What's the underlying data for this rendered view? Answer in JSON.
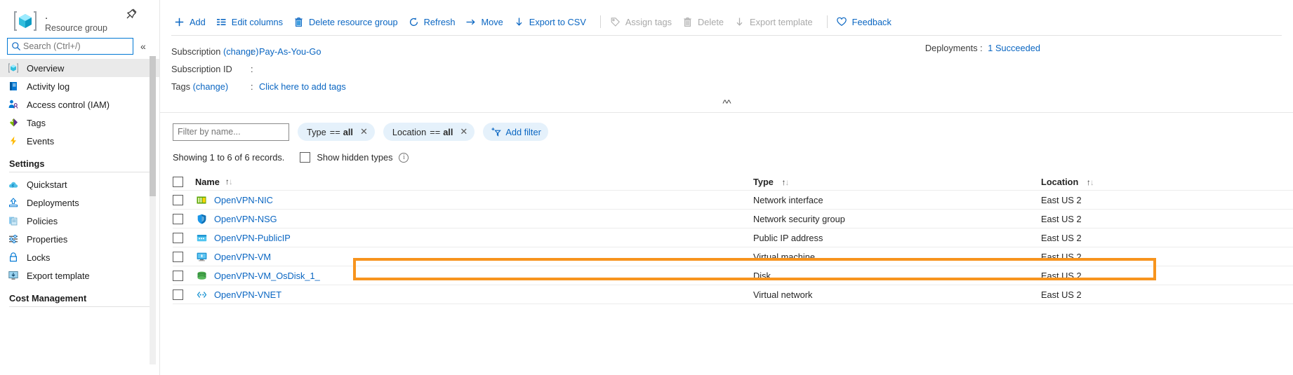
{
  "header": {
    "title": ".",
    "subtitle": "Resource group",
    "pin_icon": "pin-icon",
    "resource_group_icon": "resource-group-icon"
  },
  "search": {
    "placeholder": "Search (Ctrl+/)",
    "icon": "search-icon",
    "collapse_icon": "double-chevron-left-icon"
  },
  "sidebar": {
    "items": [
      {
        "label": "Overview",
        "icon": "resource-group-icon",
        "selected": true
      },
      {
        "label": "Activity log",
        "icon": "activity-log-icon",
        "selected": false
      },
      {
        "label": "Access control (IAM)",
        "icon": "access-control-icon",
        "selected": false
      },
      {
        "label": "Tags",
        "icon": "tags-icon",
        "selected": false
      },
      {
        "label": "Events",
        "icon": "events-icon",
        "selected": false
      }
    ],
    "groups": [
      {
        "title": "Settings",
        "items": [
          {
            "label": "Quickstart",
            "icon": "quickstart-icon"
          },
          {
            "label": "Deployments",
            "icon": "deployments-icon"
          },
          {
            "label": "Policies",
            "icon": "policies-icon"
          },
          {
            "label": "Properties",
            "icon": "properties-icon"
          },
          {
            "label": "Locks",
            "icon": "lock-icon"
          },
          {
            "label": "Export template",
            "icon": "export-template-icon"
          }
        ]
      },
      {
        "title": "Cost Management",
        "items": []
      }
    ]
  },
  "toolbar": {
    "buttons": [
      {
        "label": "Add",
        "icon": "plus-icon",
        "disabled": false
      },
      {
        "label": "Edit columns",
        "icon": "edit-columns-icon",
        "disabled": false
      },
      {
        "label": "Delete resource group",
        "icon": "trash-icon",
        "disabled": false
      },
      {
        "label": "Refresh",
        "icon": "refresh-icon",
        "disabled": false
      },
      {
        "label": "Move",
        "icon": "arrow-right-icon",
        "disabled": false
      },
      {
        "label": "Export to CSV",
        "icon": "download-icon",
        "disabled": false
      },
      {
        "label": "Assign tags",
        "icon": "tag-icon",
        "disabled": true
      },
      {
        "label": "Delete",
        "icon": "trash-icon",
        "disabled": true
      },
      {
        "label": "Export template",
        "icon": "download-icon",
        "disabled": true
      },
      {
        "label": "Feedback",
        "icon": "heart-icon",
        "disabled": false
      }
    ]
  },
  "properties": {
    "subscription_label": "Subscription",
    "subscription_change": "(change)",
    "subscription_value": "Pay-As-You-Go",
    "subscription_id_label": "Subscription ID",
    "subscription_id_value": "",
    "tags_label": "Tags",
    "tags_change": "(change)",
    "tags_value": "Click here to add tags",
    "colon": ":",
    "deployments_label": "Deployments",
    "deployments_value": "1 Succeeded",
    "collapse_icon": "double-chevron-up-icon"
  },
  "filters": {
    "name_placeholder": "Filter by name...",
    "name_value": "",
    "pills": [
      {
        "field": "Type",
        "op": "==",
        "value": "all",
        "close_icon": "close-icon"
      },
      {
        "field": "Location",
        "op": "==",
        "value": "all",
        "close_icon": "close-icon"
      }
    ],
    "add_filter_label": "Add filter",
    "add_filter_icon": "add-filter-icon"
  },
  "list_status": {
    "showing_text": "Showing 1 to 6 of 6 records.",
    "show_hidden_label": "Show hidden types",
    "show_hidden_checked": false,
    "info_icon": "info-icon"
  },
  "table": {
    "columns": [
      {
        "label": "Name",
        "sort_icon": "sort-updown-icon"
      },
      {
        "label": "Type",
        "sort_icon": "sort-updown-icon"
      },
      {
        "label": "Location",
        "sort_icon": "sort-updown-icon"
      }
    ],
    "rows": [
      {
        "name": "OpenVPN-NIC",
        "type": "Network interface",
        "location": "East US 2",
        "icon": "network-interface-icon",
        "highlighted": false
      },
      {
        "name": "OpenVPN-NSG",
        "type": "Network security group",
        "location": "East US 2",
        "icon": "network-security-group-icon",
        "highlighted": true
      },
      {
        "name": "OpenVPN-PublicIP",
        "type": "Public IP address",
        "location": "East US 2",
        "icon": "public-ip-icon",
        "highlighted": false
      },
      {
        "name": "OpenVPN-VM",
        "type": "Virtual machine",
        "location": "East US 2",
        "icon": "virtual-machine-icon",
        "highlighted": false
      },
      {
        "name": "OpenVPN-VM_OsDisk_1_",
        "type": "Disk",
        "location": "East US 2",
        "icon": "disk-icon",
        "highlighted": false
      },
      {
        "name": "OpenVPN-VNET",
        "type": "Virtual network",
        "location": "East US 2",
        "icon": "virtual-network-icon",
        "highlighted": false
      }
    ]
  },
  "colors": {
    "accent_link": "#0a66c2",
    "highlight_orange": "#f7941e",
    "selected_row_bg": "#eaeaea",
    "pill_bg": "#e5f1fb"
  }
}
